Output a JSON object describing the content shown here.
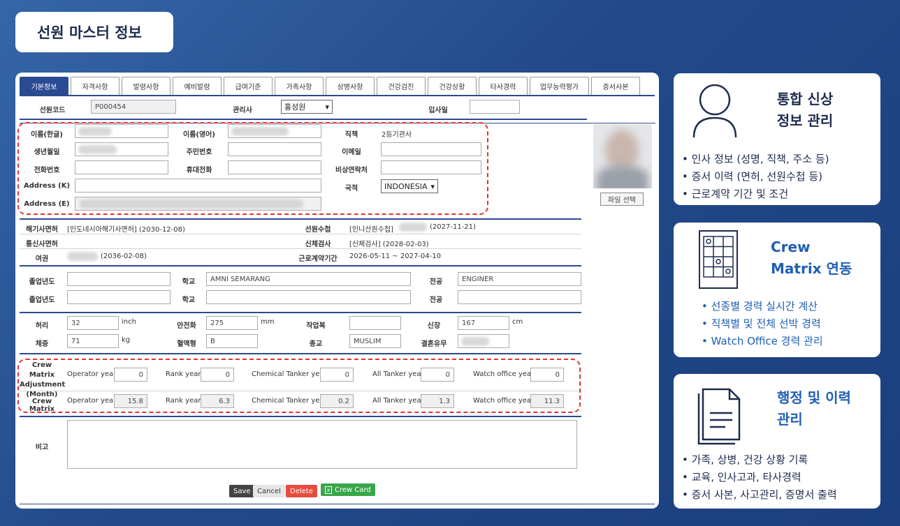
{
  "title": "선원 마스터 정보",
  "tabs": [
    "기본정보",
    "자격사항",
    "발령사항",
    "예비발령",
    "급여기준",
    "가족사항",
    "상병사항",
    "건강검진",
    "건강상황",
    "타사경력",
    "업무능력평가",
    "증서사본"
  ],
  "basic": {
    "code_label": "선원코드",
    "code_value": "P000454",
    "manager_label": "관리사",
    "manager_value": "홍성원",
    "join_label": "입사일"
  },
  "personal": {
    "name_kr": "이름(한글)",
    "name_en": "이름(영어)",
    "rank_label": "직책",
    "rank_value": "2등기관사",
    "birth": "생년월일",
    "resident_no": "주민번호",
    "email": "이메일",
    "phone": "전화번호",
    "mobile": "휴대전화",
    "emergency": "비상연락처",
    "address_k": "Address (K)",
    "nationality_label": "국적",
    "nationality_value": "INDONESIA",
    "address_e": "Address (E)",
    "file_button": "파일 선택"
  },
  "license": {
    "maritime_label": "해기사면허",
    "maritime_value": "[인도네시아해기사면허] (2030-12-08)",
    "seaman_label": "선원수첩",
    "seaman_value_a": "[인니선원수첩]",
    "seaman_value_b": "(2027-11-21)",
    "radio_label": "통신사면허",
    "physical_label": "신체검사",
    "physical_value": "[신체검사] (2028-02-03)",
    "passport_label": "여권",
    "passport_value": "(2036-02-08)",
    "contract_label": "근로계약기간",
    "contract_value": "2026-05-11 ~ 2027-04-10"
  },
  "education": {
    "grad1_label": "졸업년도",
    "school1_label": "학교",
    "school1_value": "AMNI SEMARANG",
    "major1_label": "전공",
    "major1_value": "ENGINER",
    "grad2_label": "졸업년도",
    "school2_label": "학교",
    "major2_label": "전공"
  },
  "body": {
    "waist_label": "허리",
    "waist_value": "32",
    "waist_unit": "inch",
    "shoe_label": "안전화",
    "shoe_value": "275",
    "shoe_unit": "mm",
    "workwear_label": "작업복",
    "height_label": "신장",
    "height_value": "167",
    "height_unit": "cm",
    "weight_label": "체중",
    "weight_value": "71",
    "weight_unit": "kg",
    "blood_label": "혈액형",
    "blood_value": "B",
    "religion_label": "종교",
    "religion_value": "MUSLIM",
    "married_label": "결혼유무"
  },
  "matrix": {
    "adj_label_1": "Crew Matrix",
    "adj_label_2": "Adjustment",
    "adj_label_3": "(Month)",
    "row_label": "Crew Matrix",
    "cols": [
      "Operator year",
      "Rank year",
      "Chemical Tanker year",
      "All Tanker year",
      "Watch office year"
    ],
    "adj_values": [
      "0",
      "0",
      "0",
      "0",
      "0"
    ],
    "values": [
      "15.8",
      "6.3",
      "0.2",
      "1.3",
      "11.3"
    ]
  },
  "remarks_label": "비고",
  "buttons": {
    "save": "Save",
    "cancel": "Cancel",
    "delete": "Delete",
    "crew_card": "Crew Card"
  },
  "cards": [
    {
      "heading_1": "통합 신상",
      "heading_2": "정보 관리",
      "items": [
        "인사 정보 (성명, 직책, 주소 등)",
        "증서 이력 (면허, 선원수첩 등)",
        "근로계약 기간 및 조건"
      ]
    },
    {
      "heading_1": "Crew",
      "heading_2": "Matrix 연동",
      "items": [
        "선종별 경력 실시간 계산",
        "직책별 및 전체 선박 경력",
        "Watch Office 경력 관리"
      ]
    },
    {
      "heading_1": "행정 및 이력",
      "heading_2": "관리",
      "items": [
        "가족, 상병, 건강 상황 기록",
        "교육, 인사고과, 타사경력",
        "증서 사본, 사고관리, 증명서 출력"
      ]
    }
  ],
  "colors": {
    "accent": "#2a4b92",
    "highlight": "#e5322d",
    "delete": "#e74c3c",
    "crew_card": "#3aa64a"
  }
}
